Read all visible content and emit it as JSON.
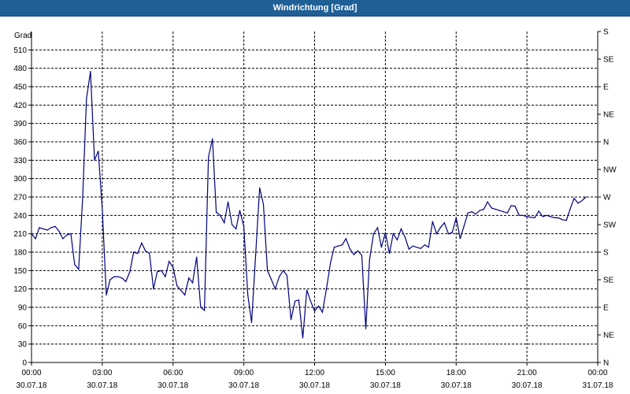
{
  "window": {
    "title": "Windrichtung [Grad]"
  },
  "colors": {
    "title_bg": "#1e5f96",
    "line": "#000080",
    "grid": "#000000"
  },
  "chart_data": {
    "type": "line",
    "title": "Windrichtung [Grad]",
    "ylabel": "Grad",
    "xlim": [
      0,
      24
    ],
    "ylim": [
      0,
      540
    ],
    "grid": true,
    "y_ticks": [
      0,
      30,
      60,
      90,
      120,
      150,
      180,
      210,
      240,
      270,
      300,
      330,
      360,
      390,
      420,
      450,
      480,
      510
    ],
    "x_ticks": [
      {
        "x": 0,
        "time": "00:00",
        "date": "30.07.18"
      },
      {
        "x": 3,
        "time": "03:00",
        "date": "30.07.18"
      },
      {
        "x": 6,
        "time": "06:00",
        "date": "30.07.18"
      },
      {
        "x": 9,
        "time": "09:00",
        "date": "30.07.18"
      },
      {
        "x": 12,
        "time": "12:00",
        "date": "30.07.18"
      },
      {
        "x": 15,
        "time": "15:00",
        "date": "30.07.18"
      },
      {
        "x": 18,
        "time": "18:00",
        "date": "30.07.18"
      },
      {
        "x": 21,
        "time": "21:00",
        "date": "30.07.18"
      },
      {
        "x": 24,
        "time": "00:00",
        "date": "31.07.18"
      }
    ],
    "right_ticks": [
      {
        "value": 0,
        "label": "N"
      },
      {
        "value": 45,
        "label": "NE"
      },
      {
        "value": 90,
        "label": "E"
      },
      {
        "value": 135,
        "label": "SE"
      },
      {
        "value": 180,
        "label": "S"
      },
      {
        "value": 225,
        "label": "SW"
      },
      {
        "value": 270,
        "label": "W"
      },
      {
        "value": 315,
        "label": "NW"
      },
      {
        "value": 360,
        "label": "N"
      },
      {
        "value": 405,
        "label": "NE"
      },
      {
        "value": 450,
        "label": "E"
      },
      {
        "value": 495,
        "label": "SE"
      },
      {
        "value": 540,
        "label": "S"
      }
    ],
    "series": [
      {
        "values": [
          [
            0.0,
            210
          ],
          [
            0.17,
            202
          ],
          [
            0.33,
            220
          ],
          [
            0.5,
            218
          ],
          [
            0.67,
            216
          ],
          [
            0.83,
            220
          ],
          [
            1.0,
            222
          ],
          [
            1.17,
            214
          ],
          [
            1.33,
            202
          ],
          [
            1.5,
            208
          ],
          [
            1.67,
            210
          ],
          [
            1.83,
            160
          ],
          [
            2.0,
            152
          ],
          [
            2.17,
            270
          ],
          [
            2.33,
            430
          ],
          [
            2.5,
            475
          ],
          [
            2.67,
            330
          ],
          [
            2.83,
            345
          ],
          [
            3.0,
            250
          ],
          [
            3.17,
            110
          ],
          [
            3.33,
            135
          ],
          [
            3.5,
            140
          ],
          [
            3.67,
            140
          ],
          [
            3.83,
            138
          ],
          [
            4.0,
            132
          ],
          [
            4.17,
            148
          ],
          [
            4.33,
            180
          ],
          [
            4.5,
            178
          ],
          [
            4.67,
            195
          ],
          [
            4.83,
            182
          ],
          [
            5.0,
            178
          ],
          [
            5.17,
            120
          ],
          [
            5.33,
            148
          ],
          [
            5.5,
            150
          ],
          [
            5.67,
            140
          ],
          [
            5.83,
            165
          ],
          [
            6.0,
            155
          ],
          [
            6.17,
            125
          ],
          [
            6.33,
            118
          ],
          [
            6.5,
            110
          ],
          [
            6.67,
            138
          ],
          [
            6.83,
            130
          ],
          [
            7.0,
            172
          ],
          [
            7.17,
            90
          ],
          [
            7.33,
            85
          ],
          [
            7.5,
            335
          ],
          [
            7.67,
            365
          ],
          [
            7.83,
            245
          ],
          [
            8.0,
            240
          ],
          [
            8.17,
            228
          ],
          [
            8.33,
            262
          ],
          [
            8.5,
            225
          ],
          [
            8.67,
            218
          ],
          [
            8.83,
            248
          ],
          [
            9.0,
            222
          ],
          [
            9.17,
            110
          ],
          [
            9.33,
            65
          ],
          [
            9.5,
            175
          ],
          [
            9.67,
            285
          ],
          [
            9.83,
            258
          ],
          [
            10.0,
            150
          ],
          [
            10.17,
            135
          ],
          [
            10.33,
            120
          ],
          [
            10.5,
            140
          ],
          [
            10.67,
            150
          ],
          [
            10.83,
            142
          ],
          [
            11.0,
            70
          ],
          [
            11.17,
            100
          ],
          [
            11.33,
            102
          ],
          [
            11.5,
            40
          ],
          [
            11.67,
            118
          ],
          [
            11.83,
            100
          ],
          [
            12.0,
            84
          ],
          [
            12.17,
            92
          ],
          [
            12.33,
            82
          ],
          [
            12.5,
            120
          ],
          [
            12.67,
            162
          ],
          [
            12.83,
            188
          ],
          [
            13.0,
            190
          ],
          [
            13.17,
            192
          ],
          [
            13.33,
            202
          ],
          [
            13.5,
            185
          ],
          [
            13.67,
            176
          ],
          [
            13.83,
            182
          ],
          [
            14.0,
            175
          ],
          [
            14.17,
            55
          ],
          [
            14.33,
            168
          ],
          [
            14.5,
            210
          ],
          [
            14.67,
            220
          ],
          [
            14.83,
            188
          ],
          [
            15.0,
            212
          ],
          [
            15.17,
            178
          ],
          [
            15.33,
            210
          ],
          [
            15.5,
            200
          ],
          [
            15.67,
            218
          ],
          [
            15.83,
            205
          ],
          [
            16.0,
            185
          ],
          [
            16.17,
            190
          ],
          [
            16.33,
            188
          ],
          [
            16.5,
            186
          ],
          [
            16.67,
            192
          ],
          [
            16.83,
            188
          ],
          [
            17.0,
            230
          ],
          [
            17.17,
            210
          ],
          [
            17.33,
            220
          ],
          [
            17.5,
            228
          ],
          [
            17.67,
            210
          ],
          [
            17.83,
            212
          ],
          [
            18.0,
            236
          ],
          [
            18.17,
            202
          ],
          [
            18.33,
            222
          ],
          [
            18.5,
            244
          ],
          [
            18.67,
            246
          ],
          [
            18.83,
            242
          ],
          [
            19.0,
            248
          ],
          [
            19.17,
            250
          ],
          [
            19.33,
            262
          ],
          [
            19.5,
            252
          ],
          [
            19.67,
            250
          ],
          [
            19.83,
            248
          ],
          [
            20.0,
            246
          ],
          [
            20.17,
            244
          ],
          [
            20.33,
            256
          ],
          [
            20.5,
            255
          ],
          [
            20.67,
            240
          ],
          [
            20.83,
            240
          ],
          [
            21.0,
            238
          ],
          [
            21.17,
            237
          ],
          [
            21.33,
            236
          ],
          [
            21.5,
            247
          ],
          [
            21.67,
            238
          ],
          [
            21.83,
            240
          ],
          [
            22.0,
            238
          ],
          [
            22.17,
            236
          ],
          [
            22.33,
            236
          ],
          [
            22.5,
            233
          ],
          [
            22.67,
            232
          ],
          [
            22.83,
            250
          ],
          [
            23.0,
            268
          ],
          [
            23.17,
            260
          ],
          [
            23.33,
            264
          ],
          [
            23.5,
            270
          ]
        ]
      }
    ]
  }
}
